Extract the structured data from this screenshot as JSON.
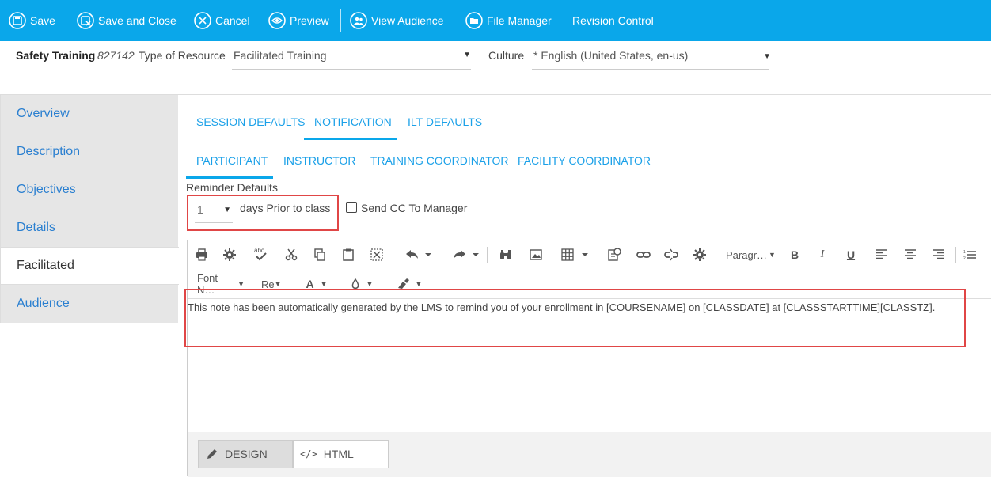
{
  "toolbar": {
    "save": "Save",
    "save_close": "Save and Close",
    "cancel": "Cancel",
    "preview": "Preview",
    "view_audience": "View Audience",
    "file_manager": "File Manager",
    "revision_control": "Revision Control"
  },
  "header": {
    "course_title": "Safety Training",
    "course_id": "827142",
    "type_label": "Type of Resource",
    "type_value": "Facilitated Training",
    "culture_label": "Culture",
    "culture_value": "* English (United States, en-us)"
  },
  "sidebar": {
    "items": [
      {
        "label": "Overview"
      },
      {
        "label": "Description"
      },
      {
        "label": "Objectives"
      },
      {
        "label": "Details"
      },
      {
        "label": "Facilitated"
      },
      {
        "label": "Audience"
      }
    ]
  },
  "tabs": {
    "main": [
      "SESSION DEFAULTS",
      "NOTIFICATION",
      "ILT DEFAULTS"
    ],
    "sub": [
      "PARTICIPANT",
      "INSTRUCTOR",
      "TRAINING COORDINATOR",
      "FACILITY COORDINATOR"
    ]
  },
  "reminder": {
    "label": "Reminder Defaults",
    "days_value": "1",
    "days_suffix": "days Prior to class",
    "cc_label": "Send CC To Manager"
  },
  "editor": {
    "paragraph": "Paragr…",
    "font_name": "Font N…",
    "font_size": "Re",
    "body": "This note has been automatically generated by the LMS to remind you of your enrollment in [COURSENAME] on [CLASSDATE] at [CLASSSTARTTIME][CLASSTZ].",
    "design_label": "DESIGN",
    "html_label": "HTML"
  },
  "colors": {
    "toolbar_bg": "#0aa7ea",
    "link_blue": "#1aa0e8",
    "highlight_red": "#e04646"
  }
}
